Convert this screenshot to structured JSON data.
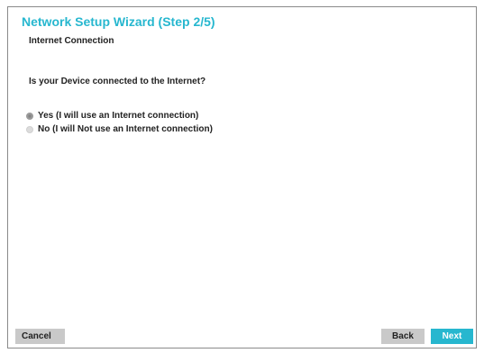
{
  "wizard": {
    "title": "Network Setup Wizard (Step 2/5)",
    "subtitle": "Internet Connection",
    "question": "Is your Device connected to the Internet?",
    "options": [
      {
        "label": "Yes (I will use an Internet connection)",
        "selected": true
      },
      {
        "label": "No (I will Not use an Internet connection)",
        "selected": false
      }
    ]
  },
  "buttons": {
    "cancel": "Cancel",
    "back": "Back",
    "next": "Next"
  },
  "colors": {
    "accent": "#27b7cf",
    "button_gray": "#c9c9c9",
    "text": "#222222"
  }
}
